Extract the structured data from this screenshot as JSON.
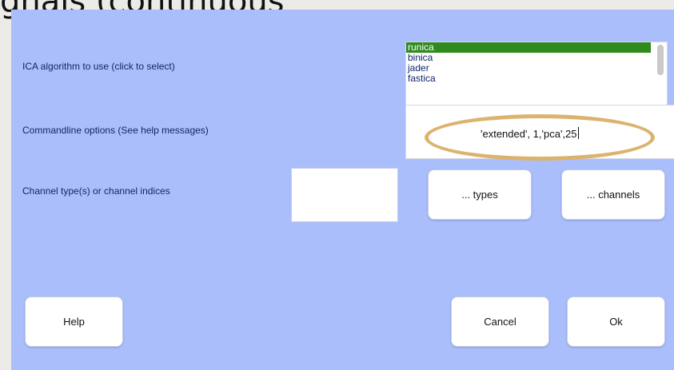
{
  "background": {
    "heading_text": "gnals (continuous"
  },
  "dialog": {
    "algorithm": {
      "label": "ICA algorithm to use (click to select)",
      "options": [
        "runica",
        "binica",
        "jader",
        "fastica"
      ],
      "selected": "runica"
    },
    "commandline": {
      "label": "Commandline options (See help messages)",
      "value": "'extended', 1,'pca',25"
    },
    "channels": {
      "label": "Channel type(s) or channel indices",
      "input_value": "",
      "types_button": "... types",
      "channels_button": "... channels"
    },
    "buttons": {
      "help": "Help",
      "cancel": "Cancel",
      "ok": "Ok"
    }
  },
  "colors": {
    "dialog_bg": "#abbefc",
    "selection": "#2f8a1f",
    "highlight": "#dcb36e",
    "label_text": "#152563"
  }
}
